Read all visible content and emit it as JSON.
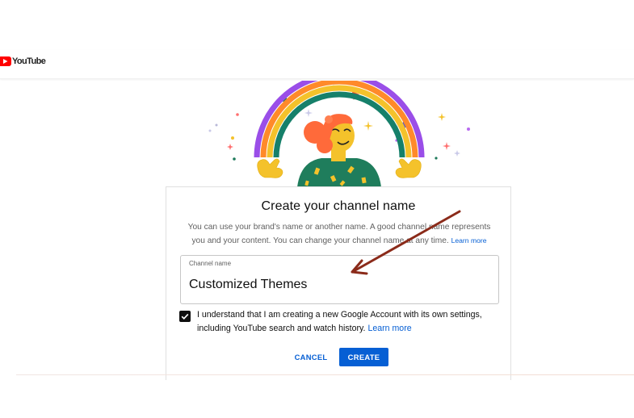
{
  "header": {
    "logo_text": "YouTube"
  },
  "dialog": {
    "title": "Create your channel name",
    "description": "You can use your brand's name or another name. A good channel name represents you and your content. You can change your channel name at any time.",
    "description_link": "Learn more",
    "field": {
      "label": "Channel name",
      "value": "Customized Themes"
    },
    "acknowledge": {
      "checked": true,
      "text": "I understand that I am creating a new Google Account with its own settings, including YouTube search and watch history.",
      "link": "Learn more"
    },
    "buttons": {
      "cancel": "CANCEL",
      "create": "CREATE"
    }
  },
  "colors": {
    "brand_red": "#ff0000",
    "link_blue": "#065fd4",
    "annotation_arrow": "#8b2b1a"
  },
  "icons": [
    "youtube-logo-icon",
    "check-icon"
  ]
}
